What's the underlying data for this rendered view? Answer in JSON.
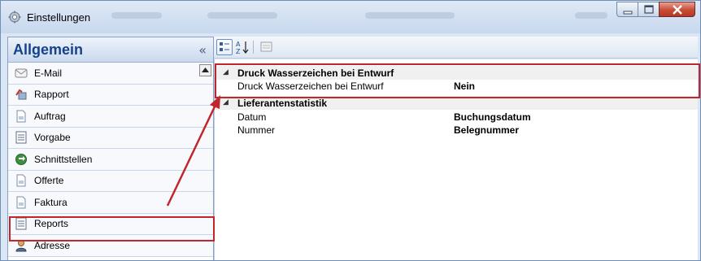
{
  "window": {
    "title": "Einstellungen",
    "icons": {
      "app": "gear-icon",
      "minimize": "minimize-icon",
      "maximize": "maximize-icon",
      "close": "close-icon"
    }
  },
  "nav": {
    "title": "Allgemein",
    "collapse_glyph": "«",
    "items": [
      {
        "label": "E-Mail",
        "icon": "email-icon"
      },
      {
        "label": "Rapport",
        "icon": "rapport-icon"
      },
      {
        "label": "Auftrag",
        "icon": "document-icon"
      },
      {
        "label": "Vorgabe",
        "icon": "form-icon"
      },
      {
        "label": "Schnittstellen",
        "icon": "interface-icon"
      },
      {
        "label": "Offerte",
        "icon": "document-icon"
      },
      {
        "label": "Faktura",
        "icon": "document-icon"
      },
      {
        "label": "Reports",
        "icon": "report-icon"
      },
      {
        "label": "Adresse",
        "icon": "person-icon"
      }
    ]
  },
  "toolbar": {
    "categorized_icon": "categorized-view-icon",
    "alphabetical_icon": "sort-alphabetical-icon",
    "pages_icon": "property-pages-icon"
  },
  "grid": {
    "categories": [
      {
        "name": "Druck Wasserzeichen bei Entwurf",
        "rows": [
          {
            "key": "Druck Wasserzeichen bei Entwurf",
            "value": "Nein"
          }
        ]
      },
      {
        "name": "Lieferantenstatistik",
        "rows": [
          {
            "key": "Datum",
            "value": "Buchungsdatum"
          },
          {
            "key": "Nummer",
            "value": "Belegnummer"
          }
        ]
      }
    ]
  },
  "colors": {
    "highlight": "#c0262c",
    "nav_title": "#15428b"
  }
}
